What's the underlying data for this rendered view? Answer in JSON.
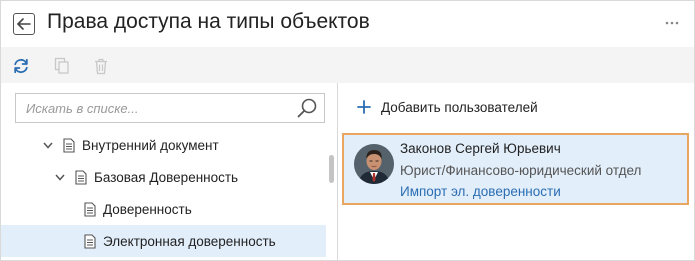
{
  "header": {
    "title": "Права доступа на типы объектов"
  },
  "toolbar": {
    "buttons": [
      "refresh-icon",
      "copy-icon",
      "delete-icon"
    ]
  },
  "search": {
    "placeholder": "Искать в списке...",
    "value": ""
  },
  "tree": {
    "items": [
      {
        "label": "Внутренний документ",
        "level": 1,
        "expanded": true,
        "selected": false
      },
      {
        "label": "Базовая Доверенность",
        "level": 2,
        "expanded": true,
        "selected": false
      },
      {
        "label": "Доверенность",
        "level": 3,
        "selected": false
      },
      {
        "label": "Электронная доверенность",
        "level": 3,
        "selected": true
      }
    ]
  },
  "right": {
    "add_users_label": "Добавить пользователей",
    "user": {
      "name": "Законов Сергей Юрьевич",
      "department": "Юрист/Финансово-юридический отдел",
      "access": "Импорт эл. доверенности"
    }
  },
  "colors": {
    "accent": "#2a6db3",
    "selection": "#e2eefa",
    "highlight_border": "#e8a661",
    "toolbar_bg": "#f4f4f4"
  }
}
